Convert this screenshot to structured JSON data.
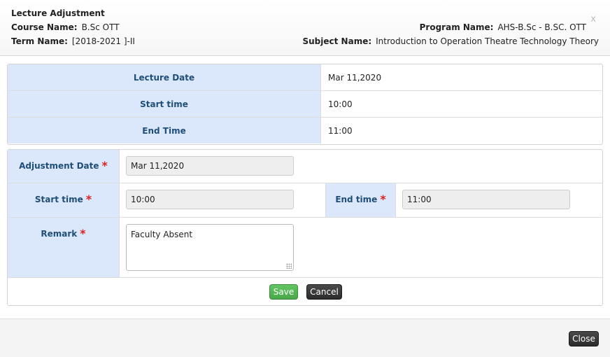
{
  "header": {
    "title": "Lecture Adjustment",
    "course_label": "Course Name:",
    "course_value": "B.Sc OTT",
    "term_label": "Term Name:",
    "term_value": "[2018-2021 ]-II",
    "program_label": "Program Name:",
    "program_value": "AHS-B.Sc - B.SC. OTT",
    "subject_label": "Subject Name:",
    "subject_value": "Introduction to Operation Theatre Technology Theory",
    "close_glyph": "x"
  },
  "lecture": {
    "date_label": "Lecture Date",
    "date_value": "Mar 11,2020",
    "start_label": "Start time",
    "start_value": "10:00",
    "end_label": "End Time",
    "end_value": "11:00"
  },
  "adjustment": {
    "date_label": "Adjustment Date",
    "date_value": "Mar 11,2020",
    "start_label": "Start time",
    "start_value": "10:00",
    "end_label": "End time",
    "end_value": "11:00",
    "remark_label": "Remark",
    "remark_value": "Faculty Absent",
    "required_mark": "*"
  },
  "actions": {
    "save_label": "Save",
    "cancel_label": "Cancel",
    "close_label": "Close"
  },
  "colors": {
    "label_bg": "#dbe8fb",
    "label_text": "#1f4e79",
    "required": "#e02020",
    "save_bg": "#5cb85c",
    "dark_btn_bg": "#333333"
  }
}
